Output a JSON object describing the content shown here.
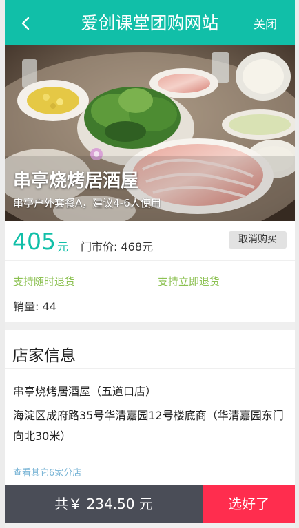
{
  "header": {
    "title": "爱创课堂团购网站",
    "close_label": "关闭",
    "color": "#11bfa8"
  },
  "hero": {
    "shop_name": "串亭烧烤居酒屋",
    "subtitle": "串亭户外套餐A，建议4-6人使用"
  },
  "price": {
    "current": "405",
    "unit": "元",
    "market_label": "门市价: 468元",
    "cancel_label": "取消购买",
    "color": "#11bfa8"
  },
  "support": {
    "tag1": "支持随时退货",
    "tag2": "支持立即退货",
    "sales": "销量: 44"
  },
  "shop": {
    "section_title": "店家信息",
    "name": "串亭烧烤居酒屋（五道口店）",
    "address": "海淀区成府路35号华清嘉园12号楼底商（华清嘉园东门向北30米）",
    "branches_link": "查看其它6家分店"
  },
  "footer": {
    "total": "共￥ 234.50 元",
    "confirm_label": "选好了",
    "confirm_color": "#ff2d4e"
  }
}
